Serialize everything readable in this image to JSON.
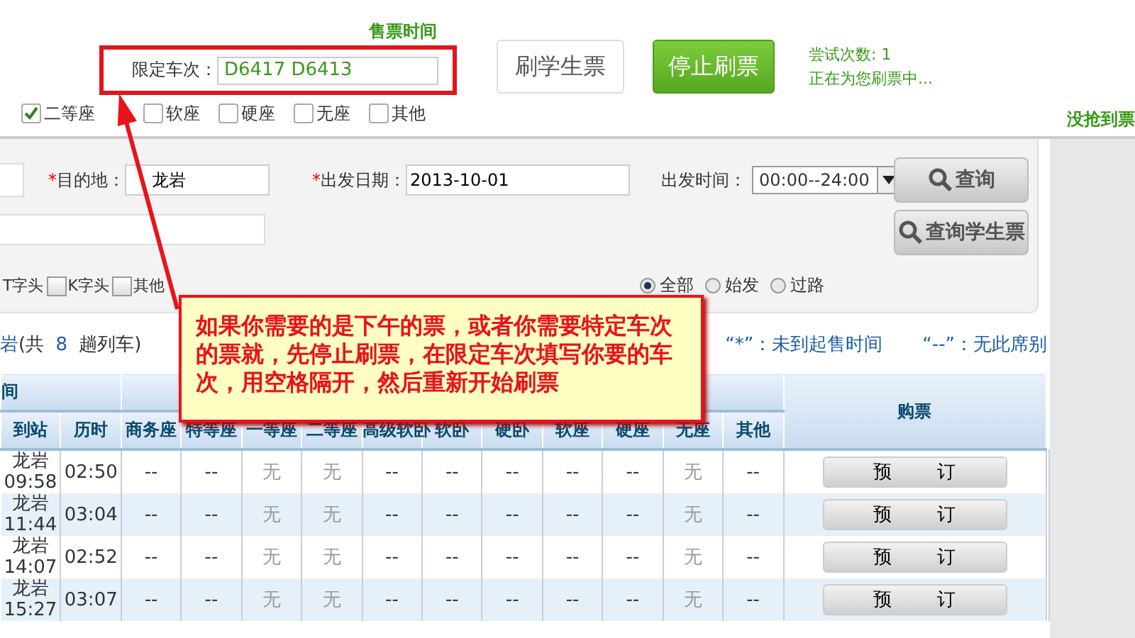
{
  "top": {
    "sale_time_label": "售票时间",
    "train_filter": {
      "label": "限定车次：",
      "value": "D6417 D6413"
    },
    "buttons": [
      {
        "label": "刷学生票",
        "kind": "plain"
      },
      {
        "label": "停止刷票",
        "kind": "primary"
      }
    ],
    "status": [
      "尝试次数: 1",
      "正在为您刷票中..."
    ],
    "seat_filters": [
      {
        "label": "二等座",
        "checked": true
      },
      {
        "label": "软座",
        "checked": false
      },
      {
        "label": "硬座",
        "checked": false
      },
      {
        "label": "无座",
        "checked": false
      },
      {
        "label": "其他",
        "checked": false
      }
    ],
    "result_note": "没抢到票"
  },
  "search": {
    "destination": {
      "mark": "*",
      "label": "目的地：",
      "value": "龙岩"
    },
    "date": {
      "mark": "*",
      "label": "出发日期：",
      "value": "2013-10-01"
    },
    "time": {
      "label": "出发时间：",
      "value": "00:00--24:00"
    },
    "buttons": [
      "查询",
      "查询学生票"
    ],
    "train_types": [
      {
        "label": "T字头"
      },
      {
        "label": "K字头",
        "checked": false
      },
      {
        "label": "其他",
        "checked": false
      }
    ],
    "origin_types": [
      {
        "label": "全部",
        "selected": true
      },
      {
        "label": "始发",
        "selected": false
      },
      {
        "label": "过路",
        "selected": false
      }
    ]
  },
  "summary": {
    "station": "岩",
    "prefix": "(共 ",
    "count": "8",
    "suffix": " 趟列车)",
    "legend": [
      "“*”：未到起售时间",
      "“--”：无此席别"
    ]
  },
  "table": {
    "group_header": "间",
    "buy_header": "购票",
    "columns": [
      "到站",
      "历时",
      "商务座",
      "特等座",
      "一等座",
      "二等座",
      "高级软卧",
      "软卧",
      "硬卧",
      "软座",
      "硬座",
      "无座",
      "其他"
    ],
    "rows": [
      {
        "station": "龙岩",
        "arrive": "09:58",
        "duration": "02:50",
        "seats": [
          "--",
          "--",
          "无",
          "无",
          "--",
          "--",
          "--",
          "--",
          "--",
          "无",
          "--"
        ],
        "button": "预 订"
      },
      {
        "station": "龙岩",
        "arrive": "11:44",
        "duration": "03:04",
        "seats": [
          "--",
          "--",
          "无",
          "无",
          "--",
          "--",
          "--",
          "--",
          "--",
          "无",
          "--"
        ],
        "button": "预 订"
      },
      {
        "station": "龙岩",
        "arrive": "14:07",
        "duration": "02:52",
        "seats": [
          "--",
          "--",
          "无",
          "无",
          "--",
          "--",
          "--",
          "--",
          "--",
          "无",
          "--"
        ],
        "button": "预 订"
      },
      {
        "station": "龙岩",
        "arrive": "15:27",
        "duration": "03:07",
        "seats": [
          "--",
          "--",
          "无",
          "无",
          "--",
          "--",
          "--",
          "--",
          "--",
          "无",
          "--"
        ],
        "button": "预 订"
      }
    ]
  },
  "callout": "如果你需要的是下午的票，或者你需要特定车次的票就，先停止刷票，在限定车次填写你要的车次，用空格隔开，然后重新开始刷票"
}
